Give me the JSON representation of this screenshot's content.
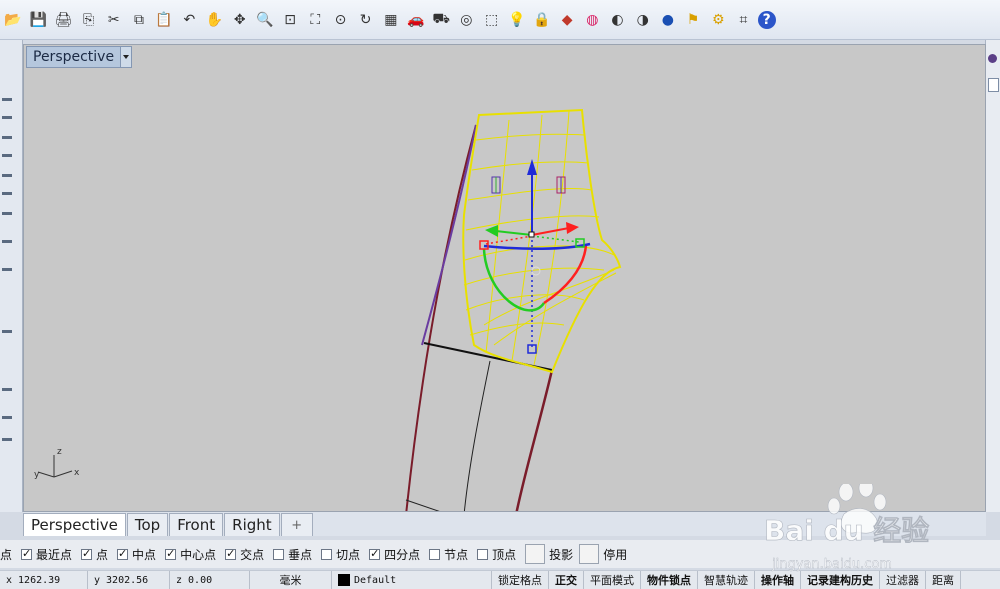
{
  "toolbar": {
    "icons": [
      "open-icon",
      "save-icon",
      "print-icon",
      "import-icon",
      "cut-icon",
      "copy-icon",
      "paste-icon",
      "undo-icon",
      "pan-icon",
      "rotate-view-icon",
      "zoom-icon",
      "zoom-window-icon",
      "zoom-extents-icon",
      "zoom-selected-icon",
      "rotate-icon",
      "grid-icon",
      "car-icon",
      "car-outline-icon",
      "target-icon",
      "select-icon",
      "light-icon",
      "lock-icon",
      "layer-icon",
      "color-wheel-icon",
      "sphere-shade-icon",
      "sphere-render-icon",
      "blue-sphere-icon",
      "flag-icon",
      "gear-icon",
      "network-icon",
      "help-icon"
    ]
  },
  "viewport": {
    "title": "Perspective",
    "axis": {
      "x": "x",
      "y": "y",
      "z": "z"
    }
  },
  "tabs": [
    {
      "label": "Perspective",
      "active": true
    },
    {
      "label": "Top",
      "active": false
    },
    {
      "label": "Front",
      "active": false
    },
    {
      "label": "Right",
      "active": false
    },
    {
      "label": "+",
      "active": false
    }
  ],
  "osnap": {
    "items": [
      {
        "label": "点",
        "checked": false
      },
      {
        "label": "最近点",
        "checked": true
      },
      {
        "label": "点",
        "checked": true
      },
      {
        "label": "中点",
        "checked": true
      },
      {
        "label": "中心点",
        "checked": true
      },
      {
        "label": "交点",
        "checked": true
      },
      {
        "label": "垂点",
        "checked": false
      },
      {
        "label": "切点",
        "checked": false
      },
      {
        "label": "四分点",
        "checked": true
      },
      {
        "label": "节点",
        "checked": false
      },
      {
        "label": "顶点",
        "checked": false
      }
    ],
    "project_label": "投影",
    "disable_label": "停用"
  },
  "status": {
    "x": "x 1262.39",
    "y": "y 3202.56",
    "z": "z 0.00",
    "unit": "毫米",
    "layer": "Default",
    "buttons": [
      {
        "label": "锁定格点",
        "bold": false
      },
      {
        "label": "正交",
        "bold": true
      },
      {
        "label": "平面模式",
        "bold": false
      },
      {
        "label": "物件锁点",
        "bold": true
      },
      {
        "label": "智慧轨迹",
        "bold": false
      },
      {
        "label": "操作轴",
        "bold": true
      },
      {
        "label": "记录建构历史",
        "bold": true
      },
      {
        "label": "过滤器",
        "bold": false
      },
      {
        "label": "距离",
        "bold": false
      }
    ]
  },
  "watermark": {
    "brand": "Bai du 经验",
    "url": "jingyan.baidu.com"
  }
}
